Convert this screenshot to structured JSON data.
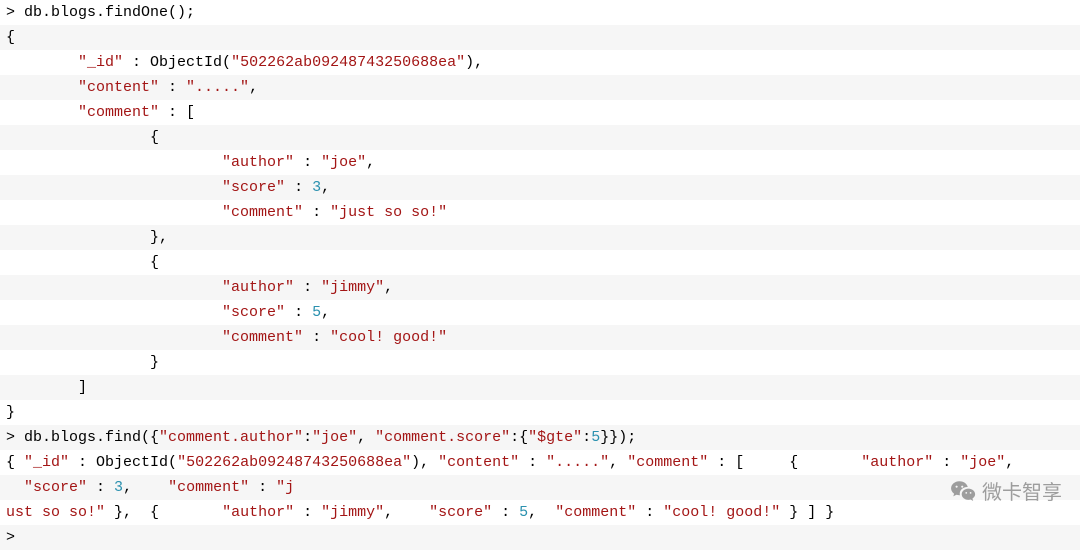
{
  "lines": [
    [
      [
        "txt",
        "> db.blogs.findOne();"
      ]
    ],
    [
      [
        "txt",
        "{"
      ]
    ],
    [
      [
        "txt",
        "        "
      ],
      [
        "str",
        "\"_id\""
      ],
      [
        "txt",
        " : ObjectId("
      ],
      [
        "str",
        "\"502262ab09248743250688ea\""
      ],
      [
        "txt",
        "),"
      ]
    ],
    [
      [
        "txt",
        "        "
      ],
      [
        "str",
        "\"content\""
      ],
      [
        "txt",
        " : "
      ],
      [
        "str",
        "\".....\""
      ],
      [
        "txt",
        ","
      ]
    ],
    [
      [
        "txt",
        "        "
      ],
      [
        "str",
        "\"comment\""
      ],
      [
        "txt",
        " : ["
      ]
    ],
    [
      [
        "txt",
        "                {"
      ]
    ],
    [
      [
        "txt",
        "                        "
      ],
      [
        "str",
        "\"author\""
      ],
      [
        "txt",
        " : "
      ],
      [
        "str",
        "\"joe\""
      ],
      [
        "txt",
        ","
      ]
    ],
    [
      [
        "txt",
        "                        "
      ],
      [
        "str",
        "\"score\""
      ],
      [
        "txt",
        " : "
      ],
      [
        "key",
        "3"
      ],
      [
        "txt",
        ","
      ]
    ],
    [
      [
        "txt",
        "                        "
      ],
      [
        "str",
        "\"comment\""
      ],
      [
        "txt",
        " : "
      ],
      [
        "str",
        "\"just so so!\""
      ]
    ],
    [
      [
        "txt",
        "                },"
      ]
    ],
    [
      [
        "txt",
        "                {"
      ]
    ],
    [
      [
        "txt",
        "                        "
      ],
      [
        "str",
        "\"author\""
      ],
      [
        "txt",
        " : "
      ],
      [
        "str",
        "\"jimmy\""
      ],
      [
        "txt",
        ","
      ]
    ],
    [
      [
        "txt",
        "                        "
      ],
      [
        "str",
        "\"score\""
      ],
      [
        "txt",
        " : "
      ],
      [
        "key",
        "5"
      ],
      [
        "txt",
        ","
      ]
    ],
    [
      [
        "txt",
        "                        "
      ],
      [
        "str",
        "\"comment\""
      ],
      [
        "txt",
        " : "
      ],
      [
        "str",
        "\"cool! good!\""
      ]
    ],
    [
      [
        "txt",
        "                }"
      ]
    ],
    [
      [
        "txt",
        "        ]"
      ]
    ],
    [
      [
        "txt",
        "}"
      ]
    ],
    [
      [
        "txt",
        "> db.blogs.find({"
      ],
      [
        "str",
        "\"comment.author\""
      ],
      [
        "txt",
        ":"
      ],
      [
        "str",
        "\"joe\""
      ],
      [
        "txt",
        ", "
      ],
      [
        "str",
        "\"comment.score\""
      ],
      [
        "txt",
        ":{"
      ],
      [
        "str",
        "\"$gte\""
      ],
      [
        "txt",
        ":"
      ],
      [
        "key",
        "5"
      ],
      [
        "txt",
        "}});"
      ]
    ],
    [
      [
        "txt",
        "{ "
      ],
      [
        "str",
        "\"_id\""
      ],
      [
        "txt",
        " : ObjectId("
      ],
      [
        "str",
        "\"502262ab09248743250688ea\""
      ],
      [
        "txt",
        "), "
      ],
      [
        "str",
        "\"content\""
      ],
      [
        "txt",
        " : "
      ],
      [
        "str",
        "\".....\""
      ],
      [
        "txt",
        ", "
      ],
      [
        "str",
        "\"comment\""
      ],
      [
        "txt",
        " : [     {       "
      ],
      [
        "str",
        "\"author\""
      ],
      [
        "txt",
        " : "
      ],
      [
        "str",
        "\"joe\""
      ],
      [
        "txt",
        ","
      ]
    ],
    [
      [
        "txt",
        "  "
      ],
      [
        "str",
        "\"score\""
      ],
      [
        "txt",
        " : "
      ],
      [
        "key",
        "3"
      ],
      [
        "txt",
        ",    "
      ],
      [
        "str",
        "\"comment\""
      ],
      [
        "txt",
        " : "
      ],
      [
        "str",
        "\"j"
      ]
    ],
    [
      [
        "str",
        "ust so so!\""
      ],
      [
        "txt",
        " },  {       "
      ],
      [
        "str",
        "\"author\""
      ],
      [
        "txt",
        " : "
      ],
      [
        "str",
        "\"jimmy\""
      ],
      [
        "txt",
        ",    "
      ],
      [
        "str",
        "\"score\""
      ],
      [
        "txt",
        " : "
      ],
      [
        "key",
        "5"
      ],
      [
        "txt",
        ",  "
      ],
      [
        "str",
        "\"comment\""
      ],
      [
        "txt",
        " : "
      ],
      [
        "str",
        "\"cool! good!\""
      ],
      [
        "txt",
        " } ] }"
      ]
    ],
    [
      [
        "txt",
        ">"
      ]
    ]
  ],
  "watermark": "微卡智享"
}
